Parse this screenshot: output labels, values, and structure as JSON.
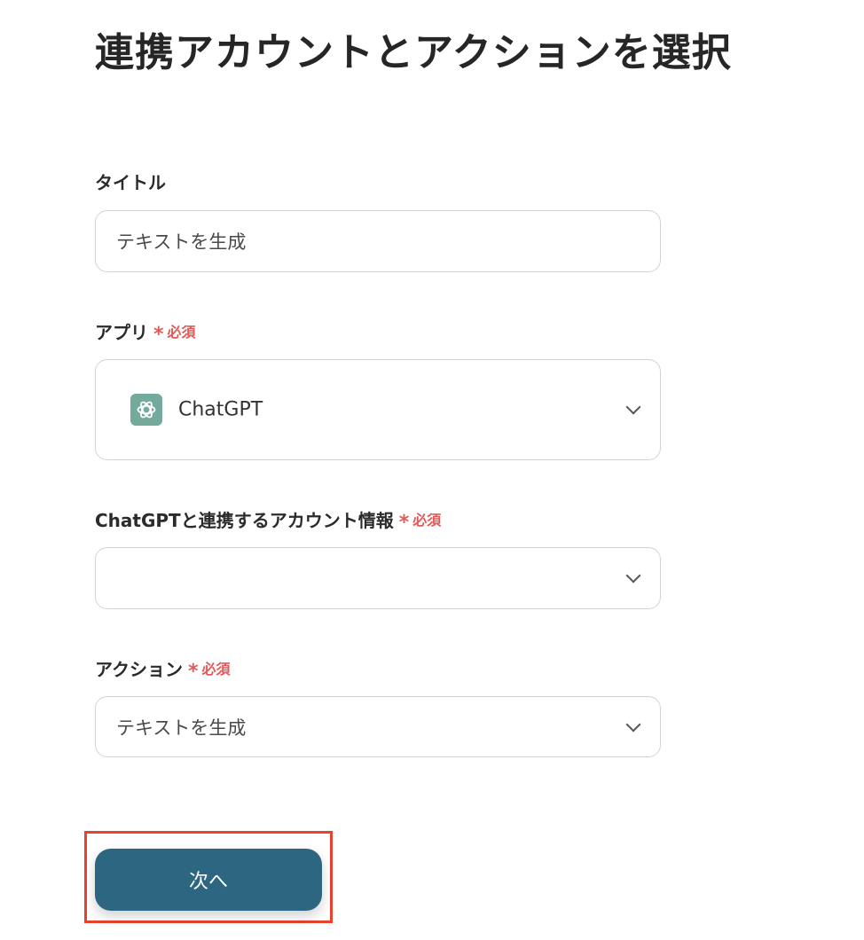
{
  "page": {
    "title": "連携アカウントとアクションを選択"
  },
  "required_marker": {
    "asterisk": "*",
    "text": "必須",
    "color": "#e05a5a"
  },
  "fields": {
    "title": {
      "label": "タイトル",
      "value": "テキストを生成"
    },
    "app": {
      "label": "アプリ",
      "selected": "ChatGPT",
      "icon": "chatgpt-logo-icon"
    },
    "account": {
      "label": "ChatGPTと連携するアカウント情報",
      "selected": ""
    },
    "action": {
      "label": "アクション",
      "selected": "テキストを生成"
    }
  },
  "buttons": {
    "next_label": "次へ",
    "next_color": "#2c6680"
  },
  "annotation": {
    "highlight_color": "#e8422f"
  }
}
